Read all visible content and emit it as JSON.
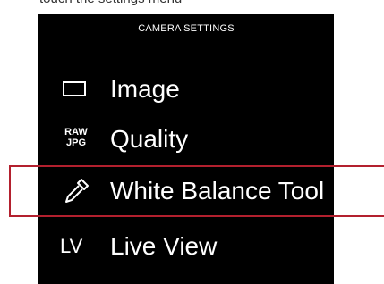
{
  "document_snippet": "touch the settings menu",
  "menu": {
    "title": "CAMERA SETTINGS",
    "items": [
      {
        "label": "Image",
        "icon": "square-outline-icon"
      },
      {
        "label": "Quality",
        "icon": "raw-jpg-icon",
        "icon_text": [
          "RAW",
          "JPG"
        ]
      },
      {
        "label": "White Balance Tool",
        "icon": "eyedropper-icon"
      },
      {
        "label": "Live View",
        "icon": "live-view-icon",
        "icon_text": "LV"
      }
    ]
  },
  "highlight": {
    "target": "White Balance Tool",
    "color": "#b3202e"
  },
  "colors": {
    "panel": "#000000",
    "text": "#ffffff"
  }
}
